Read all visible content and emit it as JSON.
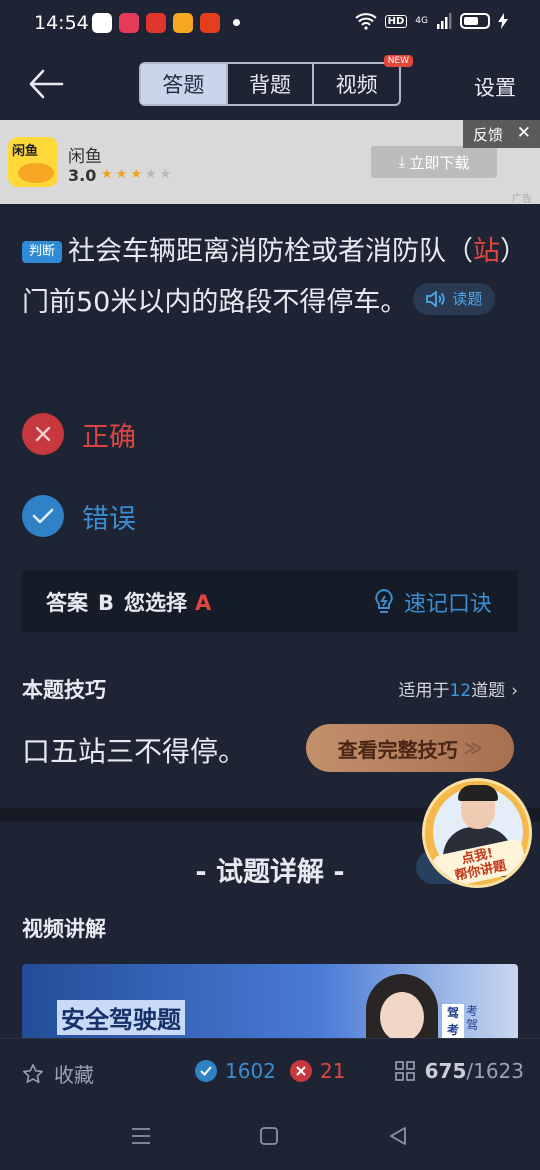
{
  "status": {
    "time": "14:54",
    "network": "4G",
    "hd": "HD"
  },
  "header": {
    "tabs": [
      {
        "label": "答题",
        "active": true
      },
      {
        "label": "背题",
        "active": false
      },
      {
        "label": "视频",
        "active": false
      }
    ],
    "new_badge": "NEW",
    "settings_label": "设置"
  },
  "ad": {
    "name": "闲鱼",
    "icon_text": "闲鱼",
    "rating": "3.0",
    "stars": 3,
    "download_label": "立即下载",
    "feedback_label": "反馈",
    "tag": "广告"
  },
  "question": {
    "type_tag": "判断",
    "text_before": "社会车辆距离消防栓或者消防队（",
    "text_highlight": "站",
    "text_after": "）门前50米以内的路段不得停车。",
    "read_label": "读题"
  },
  "options": [
    {
      "label": "正确",
      "state": "wrong"
    },
    {
      "label": "错误",
      "state": "correct"
    }
  ],
  "answer": {
    "answer_label": "答案",
    "answer_value": "B",
    "chosen_label": "您选择",
    "chosen_value": "A",
    "memo_label": "速记口诀"
  },
  "tip": {
    "heading": "本题技巧",
    "apply_prefix": "适用于",
    "apply_count": "12",
    "apply_suffix": "道题",
    "text": "口五站三不得停。",
    "button_label": "查看完整技巧"
  },
  "detail": {
    "heading": "- 试题详解 -",
    "video_heading": "视频讲解",
    "video_title": "安全驾驶题",
    "video_badge": "驾考",
    "video_badge_right": "考驾"
  },
  "helper": {
    "text_line1": "点我!",
    "text_line2": "帮你讲题"
  },
  "bottom": {
    "favorite_label": "收藏",
    "correct_count": "1602",
    "wrong_count": "21",
    "current": "675",
    "total": "/1623"
  },
  "colors": {
    "background": "#1e2433",
    "accent_blue": "#3a8dd0",
    "accent_red": "#e0463e",
    "tip_button": "#c3906c"
  }
}
